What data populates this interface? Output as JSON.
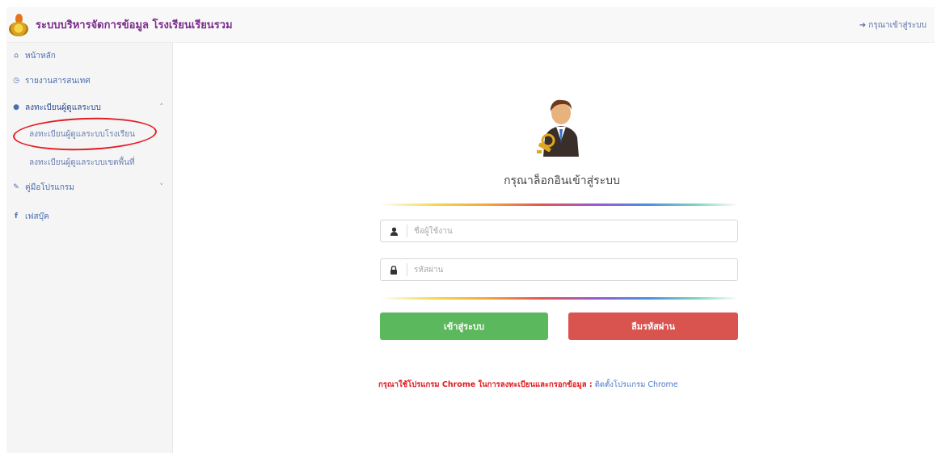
{
  "header": {
    "title": "ระบบบริหารจัดการข้อมูล โรงเรียนเรียนรวม",
    "login_link": "กรุณาเข้าสู่ระบบ"
  },
  "sidebar": {
    "items": [
      {
        "label": "หน้าหลัก",
        "icon": "home-icon"
      },
      {
        "label": "รายงานสารสนเทศ",
        "icon": "clock-icon"
      },
      {
        "label": "ลงทะเบียนผู้ดูแลระบบ",
        "icon": "user-icon"
      },
      {
        "label": "คู่มือโปรแกรม",
        "icon": "wrench-icon"
      },
      {
        "label": "เฟสบุ๊ค",
        "icon": "facebook-icon"
      }
    ],
    "subitems": [
      {
        "label": "ลงทะเบียนผู้ดูแลระบบโรงเรียน"
      },
      {
        "label": "ลงทะเบียนผู้ดูแลระบบเขตพื้นที่"
      }
    ]
  },
  "login": {
    "heading": "กรุณาล็อกอินเข้าสู่ระบบ",
    "username_placeholder": "ชื่อผู้ใช้งาน",
    "password_placeholder": "รหัสผ่าน",
    "submit_label": "เข้าสู่ระบบ",
    "forgot_label": "ลืมรหัสผ่าน"
  },
  "notice": {
    "warning": "กรุณาใช้โปรแกรม Chrome ในการลงทะเบียนและกรอกข้อมูล :",
    "link": "ติดตั้งโปรแกรม Chrome"
  },
  "colors": {
    "brand": "#7b2d8a",
    "link": "#4a6fb2",
    "success": "#5cb85c",
    "danger": "#d9534f",
    "highlight": "#e21e26"
  }
}
